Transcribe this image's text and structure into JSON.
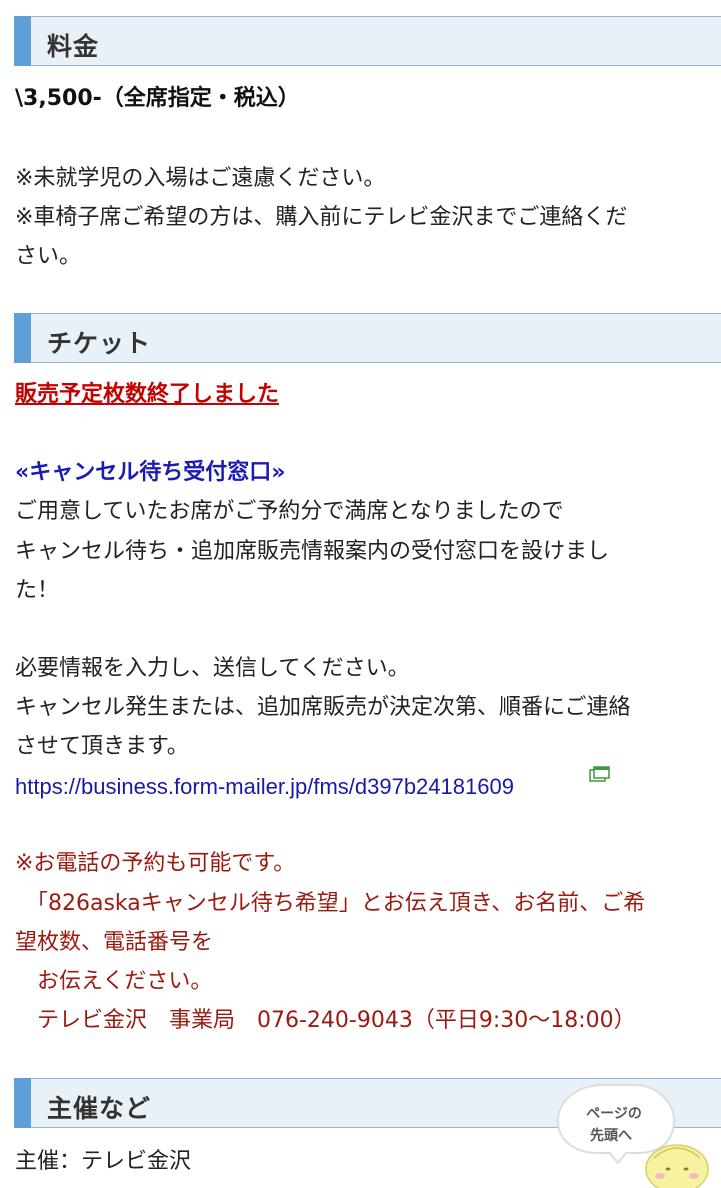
{
  "sections": {
    "fee": {
      "title": "料金",
      "price": "\\3,500-（全席指定・税込）",
      "note1": "※未就学児の入場はご遠慮ください。",
      "note2a": "※車椅子席ご希望の方は、購入前にテレビ金沢までご連絡くだ",
      "note2b": "さい。"
    },
    "ticket": {
      "title": "チケット",
      "sold_out": "販売予定枚数終了しました",
      "cancel_heading": "«キャンセル待ち受付窓口»",
      "body1": "ご用意していたお席がご予約分で満席となりましたので",
      "body2": "キャンセル待ち・追加席販売情報案内の受付窓口を設けまし",
      "body3": "た！",
      "body4": "必要情報を入力し、送信してください。",
      "body5": "キャンセル発生または、追加席販売が決定次第、順番にご連絡",
      "body6": "させて頂きます。",
      "link": "https://business.form-mailer.jp/fms/d397b24181609",
      "phone1": "※お電話の予約も可能です。",
      "phone2": "　「826askaキャンセル待ち希望」とお伝え頂き、お名前、ご希",
      "phone3": "望枚数、電話番号を",
      "phone4": "　お伝えください。",
      "phone5": "　テレビ金沢　事業局　076-240-9043（平日9:30〜18:00）"
    },
    "organizer": {
      "title": "主催など",
      "host": "主催：テレビ金沢"
    }
  },
  "back_to_top": {
    "line1": "ページの",
    "line2": "先頭へ"
  },
  "colors": {
    "header_bg": "#e8f0f8",
    "header_bar": "#5d9fd6",
    "red_text": "#c40000",
    "dark_red_text": "#9b1a10",
    "link_blue": "#1a1aa8"
  },
  "icons": {
    "external_link": "external-window-icon",
    "mascot": "mascot-character-icon"
  }
}
